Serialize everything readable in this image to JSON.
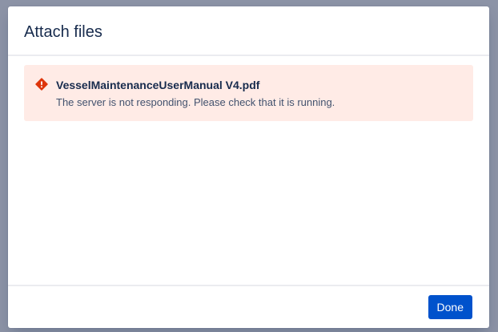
{
  "dialog": {
    "title": "Attach files",
    "error": {
      "icon": "error-warning-icon",
      "color": "#de350b",
      "filename": "VesselMaintenanceUserManual V4.pdf",
      "message": "The server is not responding. Please check that it is running."
    },
    "footer": {
      "done_label": "Done",
      "accent": "#0052cc"
    }
  }
}
